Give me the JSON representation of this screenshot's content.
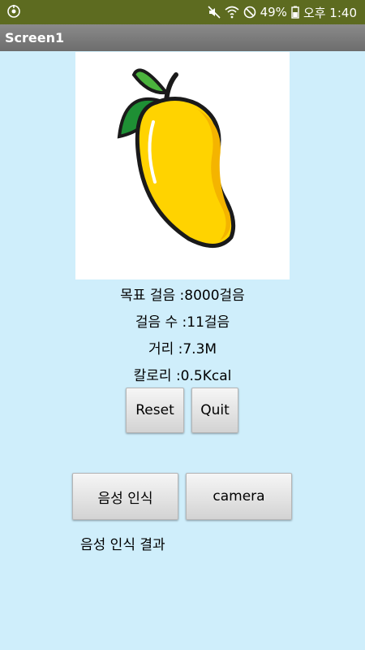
{
  "status_bar": {
    "battery_percent": "49%",
    "time": "오후 1:40",
    "icons": [
      "app-notification-icon",
      "mute-icon",
      "wifi-icon",
      "do-not-disturb-icon",
      "battery-icon"
    ]
  },
  "title_bar": {
    "title": "Screen1"
  },
  "image": {
    "icon": "mango-icon"
  },
  "stats": {
    "goal": "목표 걸음 :8000걸음",
    "steps": "걸음 수 :11걸음",
    "distance": "거리 :7.3M",
    "calories": "칼로리 :0.5Kcal"
  },
  "buttons": {
    "reset": "Reset",
    "quit": "Quit",
    "voice": "음성 인식",
    "camera": "camera"
  },
  "voice_result": "음성 인식 결과",
  "colors": {
    "background": "#cfeefb",
    "status_bar": "#5d6b20",
    "title_bar": "#7a7a7a"
  }
}
